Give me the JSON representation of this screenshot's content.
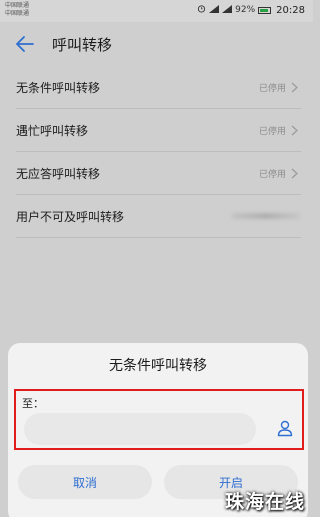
{
  "status_bar": {
    "carrier_1": "中国联通",
    "carrier_2": "中国联通",
    "battery_percent": "92%",
    "battery_level": 0.92,
    "time": "20:28"
  },
  "header": {
    "title": "呼叫转移"
  },
  "forwarding_options": [
    {
      "label": "无条件呼叫转移",
      "status": "已停用"
    },
    {
      "label": "遇忙呼叫转移",
      "status": "已停用"
    },
    {
      "label": "无应答呼叫转移",
      "status": "已停用"
    },
    {
      "label": "用户不可及呼叫转移",
      "status": ""
    }
  ],
  "dialog": {
    "title": "无条件呼叫转移",
    "to_label": "至：",
    "number_value": "",
    "cancel_label": "取消",
    "enable_label": "开启"
  },
  "watermark": "珠海在线",
  "colors": {
    "accent": "#2f6fd1",
    "highlight_border": "#e11c1c",
    "battery": "#2aa044"
  },
  "icons": [
    "back-arrow-icon",
    "chevron-right-icon",
    "contact-picker-icon",
    "battery-icon",
    "signal-icon",
    "wifi-icon",
    "alarm-icon"
  ]
}
